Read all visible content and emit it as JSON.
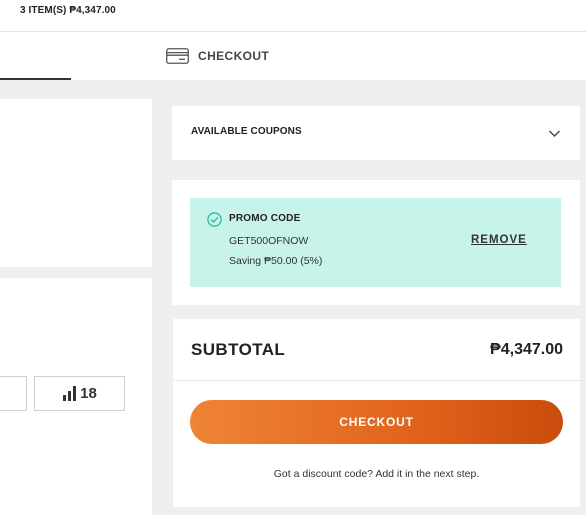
{
  "header": {
    "cart_summary": "3 ITEM(S) ₱4,347.00"
  },
  "steps": {
    "checkout_label": "CHECKOUT",
    "checkout_icon": "credit-card-icon"
  },
  "product": {
    "stock_icon": "signal-bars-icon",
    "stock_count": "18"
  },
  "coupons": {
    "title": "AVAILABLE COUPONS",
    "toggle_icon": "chevron-down-icon"
  },
  "promo": {
    "status_icon": "check-circle-icon",
    "title": "PROMO CODE",
    "code": "GET500OFNOW",
    "saving": "Saving ₱50.00 (5%)",
    "remove_label": "REMOVE",
    "box_color": "#c8f3ea"
  },
  "summary": {
    "subtotal_label": "SUBTOTAL",
    "subtotal_value": "₱4,347.00",
    "checkout_button_label": "CHECKOUT",
    "discount_note": "Got a discount code? Add it in the next step.",
    "button_gradient": [
      "#ef8435",
      "#e2661e",
      "#c94c0c"
    ]
  }
}
